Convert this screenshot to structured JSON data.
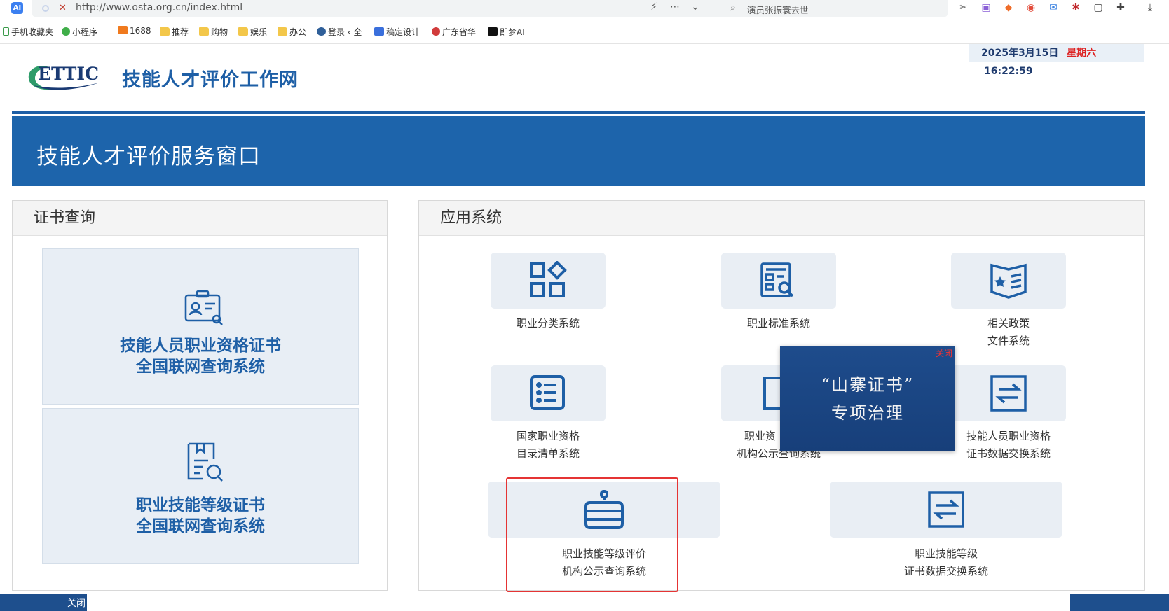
{
  "browser": {
    "app_badge": "AI",
    "url": "http://www.osta.org.cn/index.html",
    "search_text": "演员张振寰去世",
    "bookmarks": [
      "手机收藏夹",
      "小程序",
      "1688",
      "推荐",
      "购物",
      "娱乐",
      "办公",
      "登录 ‹ 全",
      "稿定设计",
      "广东省华",
      "即梦AI"
    ]
  },
  "header": {
    "date": "2025年3月15日",
    "weekday": "星期六",
    "time": "16:22:59",
    "logo_text": "ETTIC",
    "site_title": "技能人才评价工作网"
  },
  "banner": {
    "title": "技能人才评价服务窗口"
  },
  "cert_panel": {
    "title": "证书查询",
    "cards": [
      {
        "line1": "技能人员职业资格证书",
        "line2": "全国联网查询系统"
      },
      {
        "line1": "职业技能等级证书",
        "line2": "全国联网查询系统"
      }
    ]
  },
  "app_panel": {
    "title": "应用系统",
    "items": [
      {
        "line1": "职业分类系统",
        "line2": ""
      },
      {
        "line1": "职业标准系统",
        "line2": ""
      },
      {
        "line1": "相关政策",
        "line2": "文件系统"
      },
      {
        "line1": "国家职业资格",
        "line2": "目录清单系统"
      },
      {
        "line1": "职业资",
        "line2": "机构公示查询系统"
      },
      {
        "line1": "技能人员职业资格",
        "line2": "证书数据交换系统"
      },
      {
        "line1": "职业技能等级评价",
        "line2": "机构公示查询系统"
      },
      {
        "line1": "职业技能等级",
        "line2": "证书数据交换系统"
      }
    ]
  },
  "popup": {
    "close": "关闭",
    "line1": "“山寨证书”",
    "line2": "专项治理"
  },
  "bottom": {
    "close": "关闭"
  },
  "colors": {
    "brand_blue": "#1e5fa6",
    "banner_blue": "#1d64ab",
    "highlight_red": "#e53434"
  }
}
